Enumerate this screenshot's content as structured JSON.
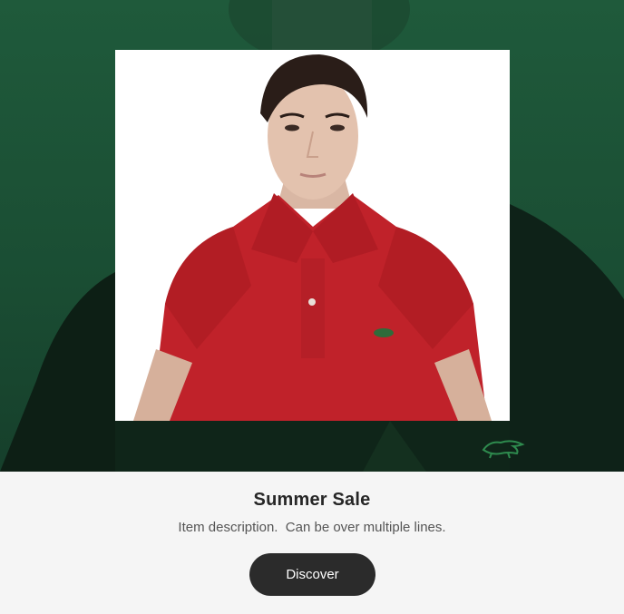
{
  "card": {
    "title": "Summer Sale",
    "description": "Item description.  Can be over multiple lines.",
    "button_label": "Discover"
  },
  "hero": {
    "background_color": "#1f5a3b",
    "frame_color": "#ffffff",
    "product_color": "#c0222a",
    "logo_icon": "crocodile-logo-icon"
  },
  "button": {
    "background_color": "#2b2b2b",
    "text_color": "#ffffff"
  }
}
